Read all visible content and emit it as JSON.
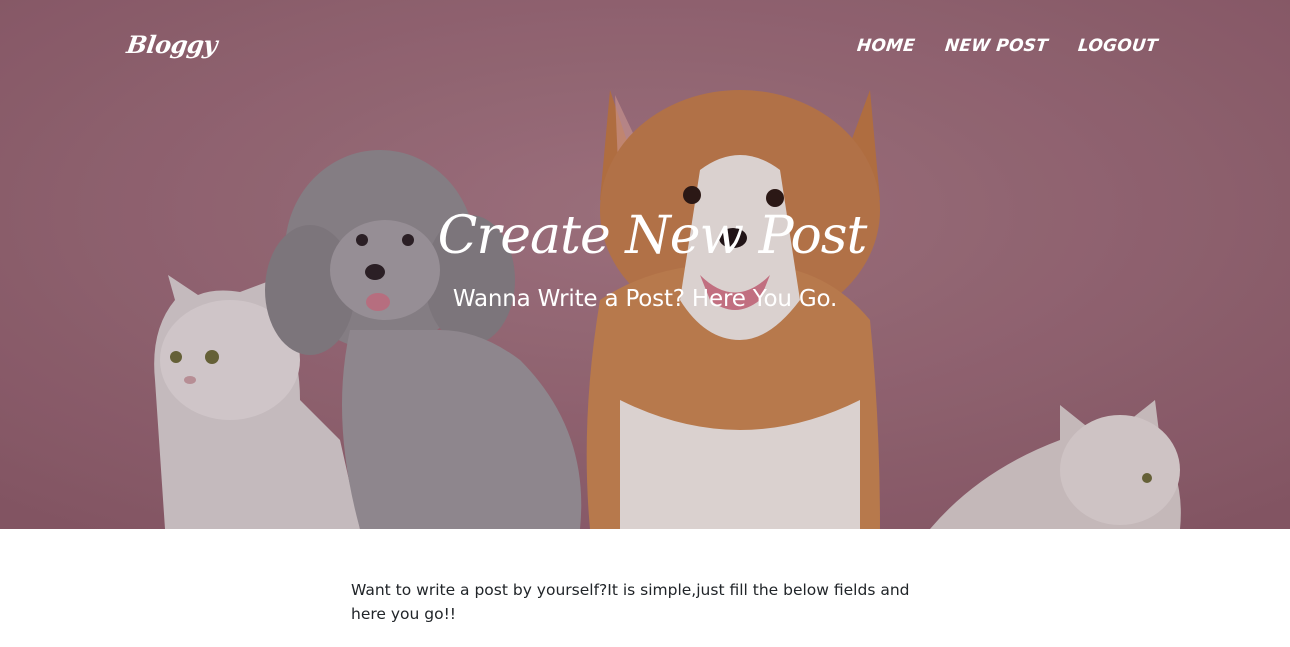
{
  "brand": "Bloggy",
  "nav": {
    "items": [
      {
        "label": "HOME"
      },
      {
        "label": "NEW POST"
      },
      {
        "label": "LOGOUT"
      }
    ]
  },
  "hero": {
    "title": "Create New Post",
    "subtitle": "Wanna Write a Post? Here You Go.",
    "background_color": "#9a6e7b"
  },
  "main": {
    "intro": "Want to write a post by yourself?It is simple,just fill the below fields and here you go!!"
  }
}
